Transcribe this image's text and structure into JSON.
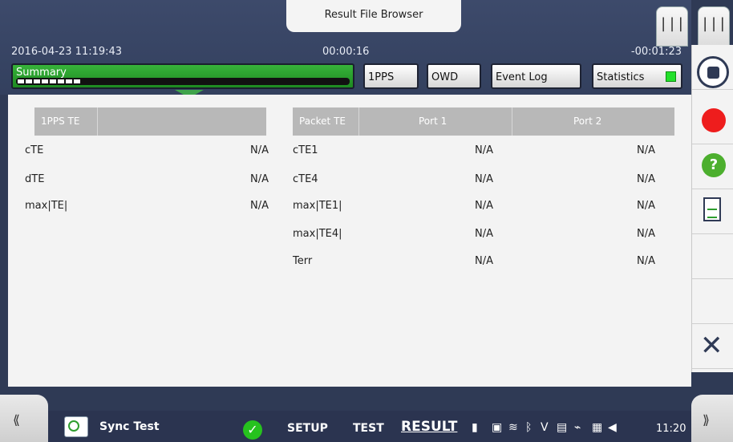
{
  "header": {
    "file_browser_title": "Result File Browser",
    "datetime": "2016-04-23 11:19:43",
    "elapsed": "00:00:16",
    "remaining": "-00:01:23",
    "buttons": {
      "summary": "Summary",
      "pps": "1PPS",
      "owd": "OWD",
      "event_log": "Event Log",
      "statistics": "Statistics"
    }
  },
  "side_tabs": {
    "tab1": "|||",
    "tab2": "|||"
  },
  "table_1pps": {
    "header": "1PPS TE",
    "rows": [
      {
        "label": "cTE",
        "value": "N/A"
      },
      {
        "label": "dTE",
        "value": "N/A"
      },
      {
        "label": "max|TE|",
        "value": "N/A"
      }
    ]
  },
  "table_packet": {
    "header": "Packet TE",
    "col1": "Port 1",
    "col2": "Port 2",
    "rows": [
      {
        "label": "cTE1",
        "p1": "N/A",
        "p2": "N/A"
      },
      {
        "label": "cTE4",
        "p1": "N/A",
        "p2": "N/A"
      },
      {
        "label": "max|TE1|",
        "p1": "N/A",
        "p2": "N/A"
      },
      {
        "label": "max|TE4|",
        "p1": "N/A",
        "p2": "N/A"
      },
      {
        "label": "Terr",
        "p1": "N/A",
        "p2": "N/A"
      }
    ]
  },
  "bottom": {
    "left_tab": "⟪",
    "right_tab": "⟫",
    "app_name": "Sync Test",
    "nav_setup": "SETUP",
    "nav_test": "TEST",
    "nav_result": "RESULT",
    "clock": "11:20"
  },
  "colors": {
    "accent_green": "#1e8a21",
    "record_red": "#ee1d1d",
    "frame": "#2f3a55"
  },
  "icons": [
    "stop-icon",
    "record-icon",
    "help-icon",
    "report-icon",
    "close-icon",
    "check-icon"
  ]
}
